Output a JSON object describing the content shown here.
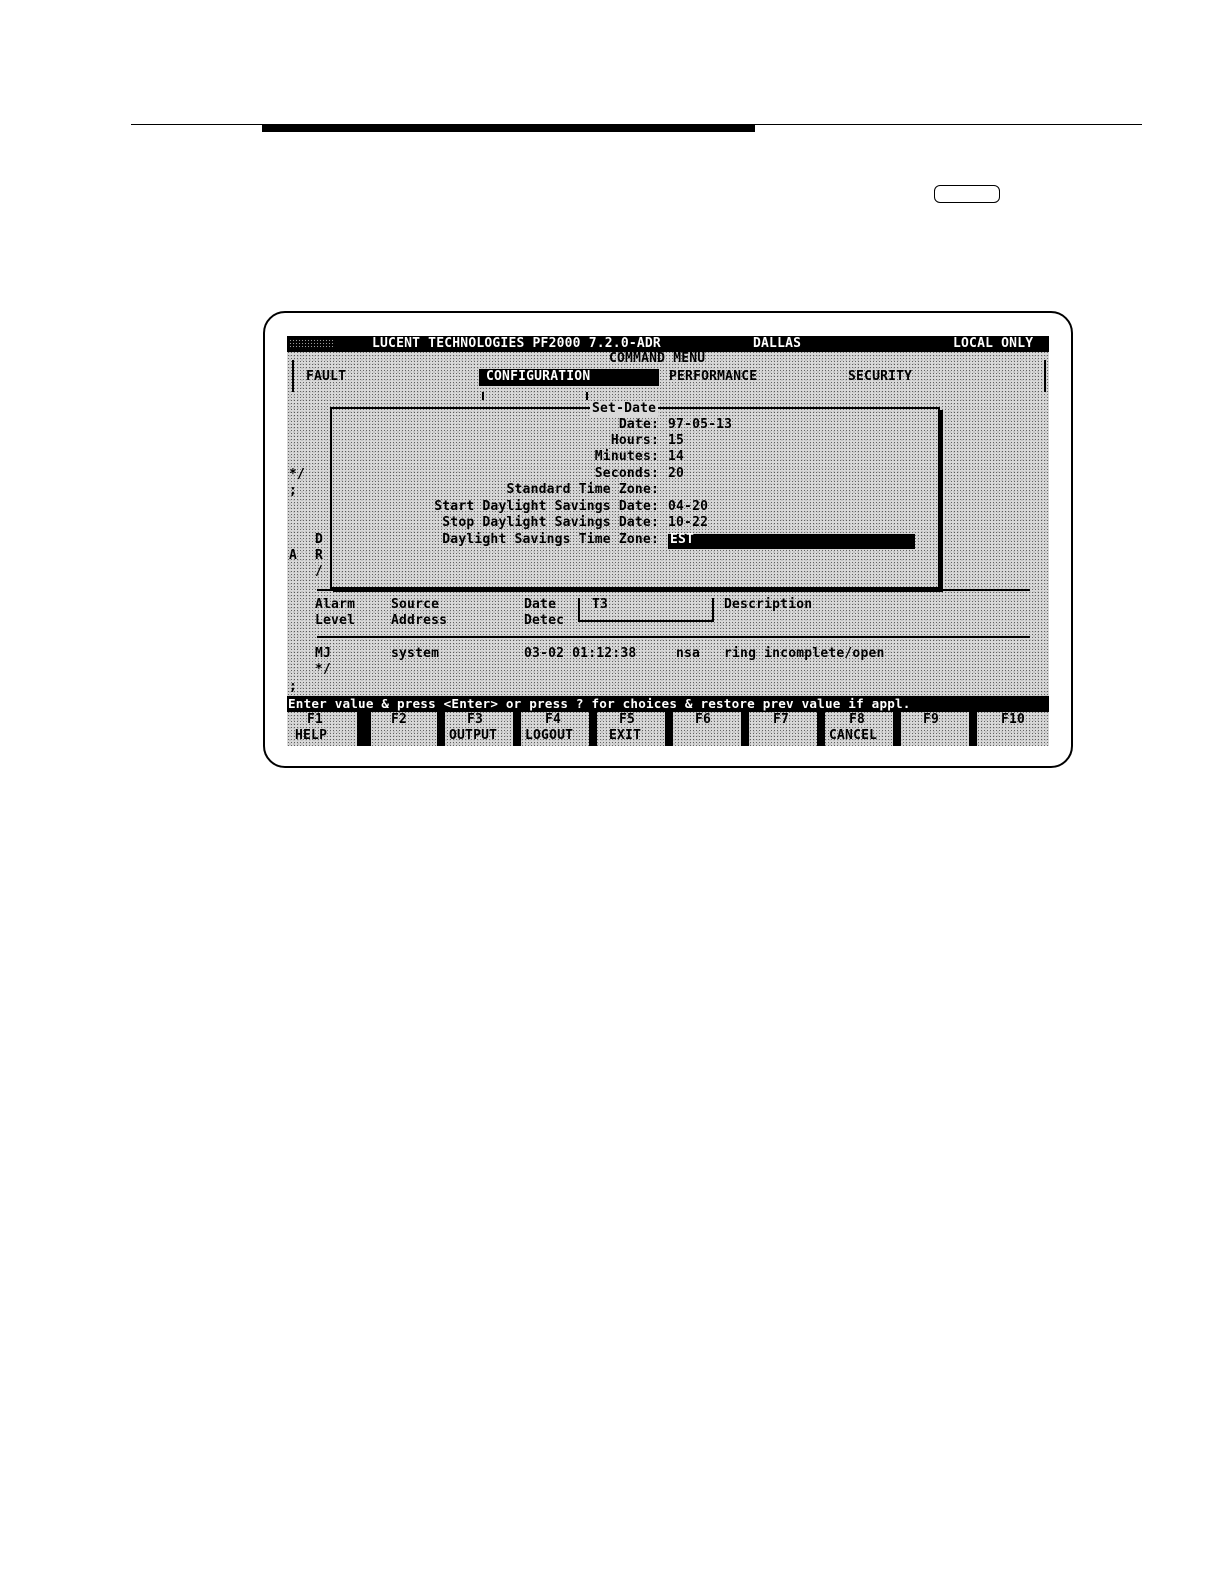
{
  "terminal": {
    "title_bar": {
      "product": "LUCENT TECHNOLOGIES PF2000 7.2.0-ADR",
      "site": "DALLAS",
      "mode": "LOCAL ONLY"
    },
    "command_menu": {
      "label": "COMMAND MENU",
      "items": [
        "FAULT",
        "CONFIGURATION",
        "PERFORMANCE",
        "SECURITY"
      ],
      "selected": "CONFIGURATION"
    },
    "dialog": {
      "title": "Set-Date",
      "fields": [
        {
          "label": "Date:",
          "value": "97-05-13"
        },
        {
          "label": "Hours:",
          "value": "15"
        },
        {
          "label": "Minutes:",
          "value": "14"
        },
        {
          "label": "Seconds:",
          "value": "20"
        },
        {
          "label": "Standard Time Zone:",
          "value": ""
        },
        {
          "label": "Start Daylight Savings Date:",
          "value": "04-20"
        },
        {
          "label": "Stop Daylight Savings Date:",
          "value": "10-22"
        },
        {
          "label": "Daylight Savings Time Zone:",
          "value": "EST"
        }
      ]
    },
    "background_fragments": [
      "*/",
      ";",
      "D",
      "A",
      "R",
      "/"
    ],
    "alarm_table": {
      "headers_row1": [
        "Alarm",
        "Source",
        "Date",
        "T3",
        "Description"
      ],
      "headers_row2": [
        "Level",
        "Address",
        "Detec"
      ],
      "separator": "==================================================================================",
      "rows": [
        {
          "level": "MJ",
          "source": "system",
          "date": "03-02 01:12:38",
          "svc": "nsa",
          "description": "ring incomplete/open"
        }
      ],
      "trailer": "*/",
      "terminator": ";"
    },
    "prompt": "Enter value & press <Enter> or press ? for choices & restore prev value if appl.",
    "function_keys": [
      {
        "key": "F1",
        "label": "HELP"
      },
      {
        "key": "F2",
        "label": ""
      },
      {
        "key": "F3",
        "label": "OUTPUT"
      },
      {
        "key": "F4",
        "label": "LOGOUT"
      },
      {
        "key": "F5",
        "label": "EXIT"
      },
      {
        "key": "F6",
        "label": ""
      },
      {
        "key": "F7",
        "label": ""
      },
      {
        "key": "F8",
        "label": "CANCEL"
      },
      {
        "key": "F9",
        "label": ""
      },
      {
        "key": "F10",
        "label": ""
      }
    ]
  }
}
